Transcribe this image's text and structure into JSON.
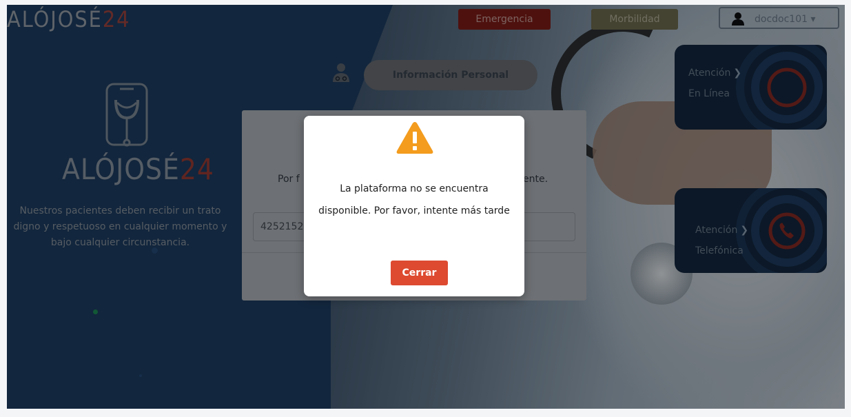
{
  "header": {
    "logo_main": "ALÓJOSÉ",
    "logo_num": "24",
    "emergencia_label": "Emergencia",
    "morbilidad_label": "Morbilidad",
    "user_name": "docdoc101",
    "user_caret": "▾"
  },
  "brand": {
    "logo_main": "ALÓJOSÉ",
    "logo_num": "24",
    "tagline_line1": "Nuestros pacientes deben recibir un trato",
    "tagline_line2": "digno y respetuoso en cualquier momento y",
    "tagline_line3": "bajo cualquier circunstancia."
  },
  "personal_info": {
    "label": "Información Personal"
  },
  "cards": {
    "online_line1": "Atención",
    "online_line2": "En Línea",
    "phone_line1": "Atención",
    "phone_line2": "Telefónica",
    "chevron": "❯"
  },
  "background_modal": {
    "text_left": "Por f",
    "text_right": "ente.",
    "input_value": "4252152"
  },
  "alert": {
    "message": "La plataforma no se encuentra disponible. Por favor, intente más tarde",
    "close_label": "Cerrar"
  },
  "colors": {
    "alert_button": "#dd4a30",
    "warning": "#f39c1e",
    "navy": "#1d3e63"
  }
}
